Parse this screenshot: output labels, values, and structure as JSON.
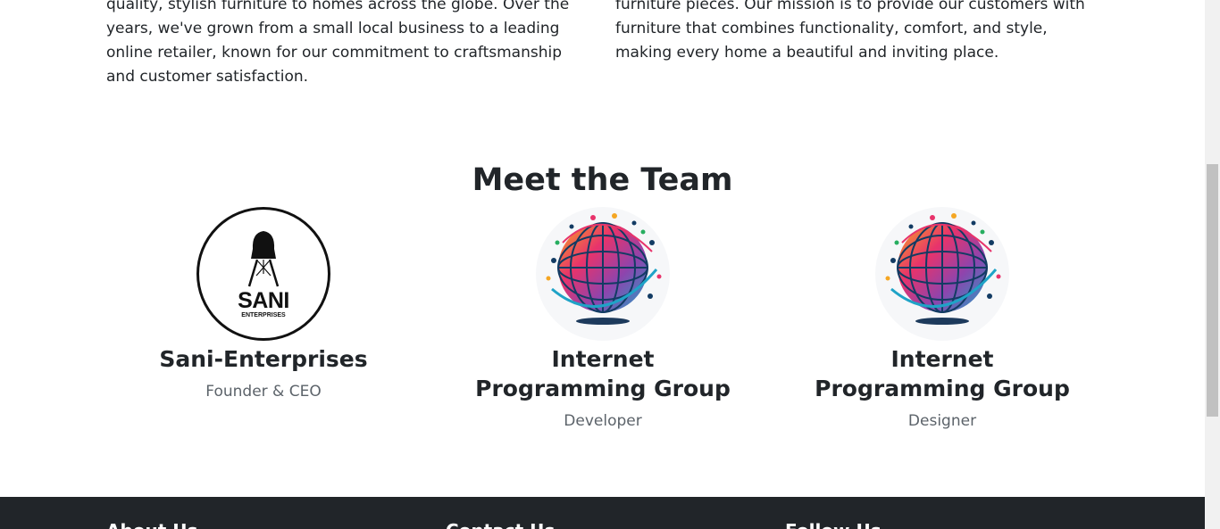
{
  "about": {
    "left_paragraph": "quality, stylish furniture to homes across the globe. Over the years, we've grown from a small local business to a leading online retailer, known for our commitment to craftsmanship and customer satisfaction.",
    "right_paragraph": "furniture pieces. Our mission is to provide our customers with furniture that combines functionality, comfort, and style, making every home a beautiful and inviting place."
  },
  "team": {
    "title": "Meet the Team",
    "members": [
      {
        "name": "Sani-Enterprises",
        "role": "Founder & CEO",
        "avatar": "sani-enterprises-logo",
        "logo_text": "SANI",
        "logo_subtext": "ENTERPRISES"
      },
      {
        "name": "Internet Programming Group",
        "role": "Developer",
        "avatar": "globe-network-logo"
      },
      {
        "name": "Internet Programming Group",
        "role": "Designer",
        "avatar": "globe-network-logo"
      }
    ]
  },
  "footer": {
    "headings": [
      "About Us",
      "Contact Us",
      "Follow Us"
    ],
    "background": "#212529"
  },
  "colors": {
    "text": "#212529",
    "muted": "#5c636a",
    "footer_bg": "#212529"
  }
}
